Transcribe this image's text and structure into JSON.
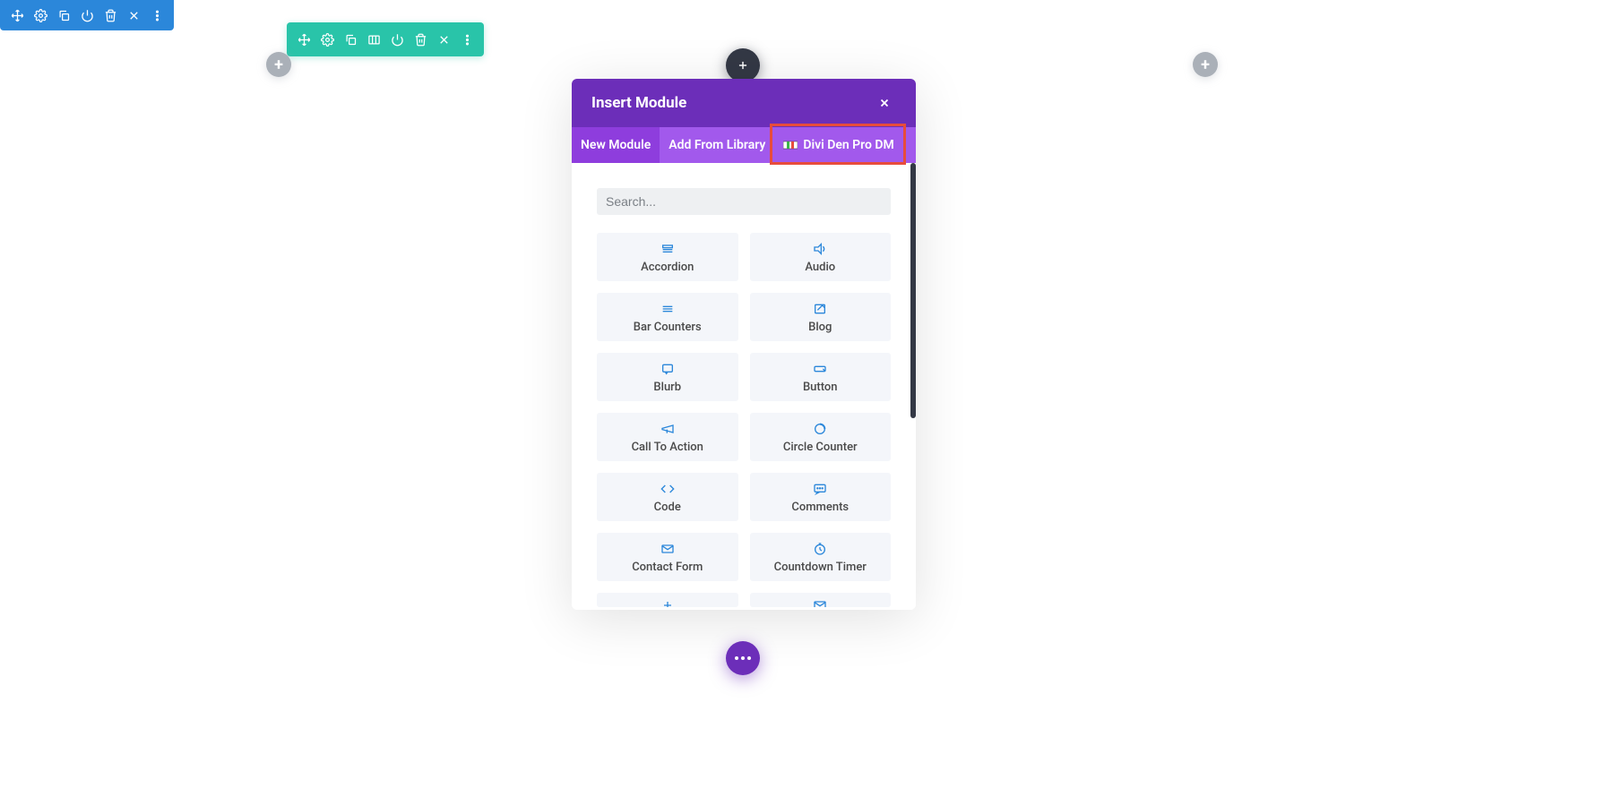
{
  "colors": {
    "blue_toolbar": "#2b87da",
    "green_toolbar": "#29c4a9",
    "gray_circle": "#aab0b8",
    "dark_circle": "#333845",
    "modal_header": "#6c2eb9",
    "modal_tabs": "#a259ec",
    "modal_tab_active": "#8e3ddd",
    "highlight_border": "#e74c3c",
    "card_bg": "#f4f6fa",
    "icon_blue": "#2b87da",
    "floating": "#6c2eb9"
  },
  "section_toolbar_icons": [
    "move",
    "settings",
    "duplicate",
    "power",
    "trash",
    "close",
    "more"
  ],
  "row_toolbar_icons": [
    "move",
    "settings",
    "duplicate",
    "columns",
    "power",
    "trash",
    "close",
    "more"
  ],
  "modal": {
    "title": "Insert Module",
    "tabs": [
      {
        "label": "New Module",
        "active": true
      },
      {
        "label": "Add From Library",
        "active": false
      },
      {
        "label": "Divi Den Pro DM",
        "active": false,
        "icon": true,
        "highlighted": true
      }
    ],
    "search_placeholder": "Search...",
    "modules": [
      {
        "label": "Accordion",
        "icon": "accordion"
      },
      {
        "label": "Audio",
        "icon": "audio"
      },
      {
        "label": "Bar Counters",
        "icon": "bars"
      },
      {
        "label": "Blog",
        "icon": "blog"
      },
      {
        "label": "Blurb",
        "icon": "blurb"
      },
      {
        "label": "Button",
        "icon": "button"
      },
      {
        "label": "Call To Action",
        "icon": "cta"
      },
      {
        "label": "Circle Counter",
        "icon": "circle"
      },
      {
        "label": "Code",
        "icon": "code"
      },
      {
        "label": "Comments",
        "icon": "comments"
      },
      {
        "label": "Contact Form",
        "icon": "mail"
      },
      {
        "label": "Countdown Timer",
        "icon": "timer"
      },
      {
        "label": "",
        "icon": "plus-partial"
      },
      {
        "label": "",
        "icon": "mail-partial"
      }
    ]
  }
}
